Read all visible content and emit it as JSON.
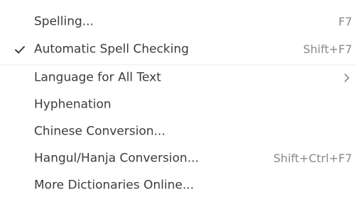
{
  "menu": {
    "items": [
      {
        "label": "Spelling...",
        "shortcut": "F7",
        "checked": false,
        "submenu": false
      },
      {
        "label": "Automatic Spell Checking",
        "shortcut": "Shift+F7",
        "checked": true,
        "submenu": false
      },
      {
        "label": "Language for All Text",
        "shortcut": "",
        "checked": false,
        "submenu": true
      },
      {
        "label": "Hyphenation",
        "shortcut": "",
        "checked": false,
        "submenu": false
      },
      {
        "label": "Chinese Conversion...",
        "shortcut": "",
        "checked": false,
        "submenu": false
      },
      {
        "label": "Hangul/Hanja Conversion...",
        "shortcut": "Shift+Ctrl+F7",
        "checked": false,
        "submenu": false
      },
      {
        "label": "More Dictionaries Online...",
        "shortcut": "",
        "checked": false,
        "submenu": false
      }
    ]
  },
  "icons": {
    "check": "checkmark-icon",
    "submenu": "chevron-right-icon"
  },
  "colors": {
    "text": "#3c3c3c",
    "shortcut": "#8a8a8a",
    "separator": "#ededed",
    "background": "#ffffff"
  }
}
